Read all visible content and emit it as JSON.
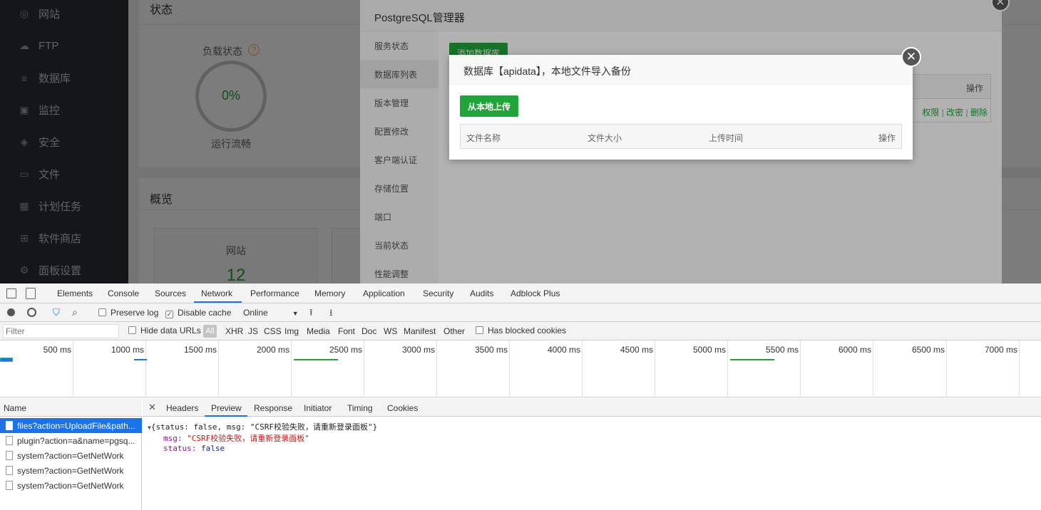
{
  "sidebar": {
    "items": [
      {
        "label": "网站",
        "icon": "globe-icon"
      },
      {
        "label": "FTP",
        "icon": "ftp-icon"
      },
      {
        "label": "数据库",
        "icon": "database-icon"
      },
      {
        "label": "监控",
        "icon": "monitor-icon"
      },
      {
        "label": "安全",
        "icon": "shield-icon"
      },
      {
        "label": "文件",
        "icon": "folder-icon"
      },
      {
        "label": "计划任务",
        "icon": "calendar-icon"
      },
      {
        "label": "软件商店",
        "icon": "apps-icon"
      },
      {
        "label": "面板设置",
        "icon": "gear-icon"
      }
    ]
  },
  "main": {
    "status_title": "状态",
    "load_label": "负载状态",
    "load_value": "0%",
    "load_status": "运行流畅",
    "overview_title": "概览",
    "site_label": "网站",
    "site_count": "12"
  },
  "pg_manager": {
    "title": "PostgreSQL管理器",
    "add_db_button": "添加数据库",
    "col_action": "操作",
    "row_actions": [
      "权限",
      "改密",
      "删除"
    ],
    "menu": [
      "服务状态",
      "数据库列表",
      "版本管理",
      "配置修改",
      "客户端认证",
      "存储位置",
      "端口",
      "当前状态",
      "性能调整"
    ],
    "active_menu": "数据库列表"
  },
  "dialog": {
    "title": "数据库【apidata】，本地文件导入备份",
    "upload_button": "从本地上传",
    "columns": [
      "文件名称",
      "文件大小",
      "上传时间",
      "操作"
    ]
  },
  "devtools": {
    "tabs": [
      "Elements",
      "Console",
      "Sources",
      "Network",
      "Performance",
      "Memory",
      "Application",
      "Security",
      "Audits",
      "Adblock Plus"
    ],
    "active_tab": "Network",
    "toolbar": {
      "preserve_log": "Preserve log",
      "disable_cache": "Disable cache",
      "throttle": "Online"
    },
    "filterbar": {
      "placeholder": "Filter",
      "hide_data_urls": "Hide data URLs",
      "all": "All",
      "types": [
        "XHR",
        "JS",
        "CSS",
        "Img",
        "Media",
        "Font",
        "Doc",
        "WS",
        "Manifest",
        "Other"
      ],
      "has_blocked": "Has blocked cookies"
    },
    "timeline_labels": [
      "500 ms",
      "1000 ms",
      "1500 ms",
      "2000 ms",
      "2500 ms",
      "3000 ms",
      "3500 ms",
      "4000 ms",
      "4500 ms",
      "5000 ms",
      "5500 ms",
      "6000 ms",
      "6500 ms",
      "7000 ms"
    ],
    "name_header": "Name",
    "requests": [
      "files?action=UploadFile&path...",
      "plugin?action=a&name=pgsq...",
      "system?action=GetNetWork",
      "system?action=GetNetWork",
      "system?action=GetNetWork"
    ],
    "detail_tabs": [
      "Headers",
      "Preview",
      "Response",
      "Initiator",
      "Timing",
      "Cookies"
    ],
    "active_detail_tab": "Preview",
    "preview": {
      "summary": "{status: false, msg: \"CSRF校验失败，请重新登录面板\"}",
      "msg_key": "msg:",
      "msg_value": "\"CSRF校验失败，请重新登录面板\"",
      "status_key": "status:",
      "status_value": "false"
    }
  }
}
